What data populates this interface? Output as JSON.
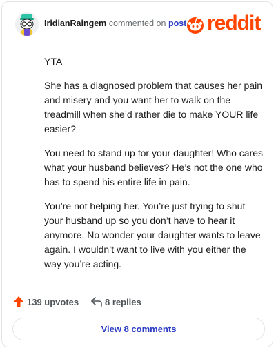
{
  "header": {
    "username": "IridianRaingem",
    "action_text": "commented on",
    "post_link": "post",
    "logo_text": "reddit",
    "brand_color": "#ff4500"
  },
  "comment": {
    "paragraphs": [
      "YTA",
      "She has a diagnosed problem that causes her pain and misery and you want her to walk on the treadmill when she’d rather die to make YOUR life easier?",
      "You need to stand up for your daughter! Who cares what your husband believes? He’s not the one who has to spend his entire life in pain.",
      "You’re not helping her. You’re just trying to shut your husband up so you don’t have to hear it anymore. No wonder your daughter wants to leave again. I wouldn’t want to live with you either the way you’re acting."
    ]
  },
  "actions": {
    "upvotes": "139 upvotes",
    "replies": "8 replies",
    "upvote_icon": "upvote-arrow-icon",
    "reply_icon": "reply-arrow-icon"
  },
  "footer": {
    "view_comments_label": "View 8 comments"
  }
}
